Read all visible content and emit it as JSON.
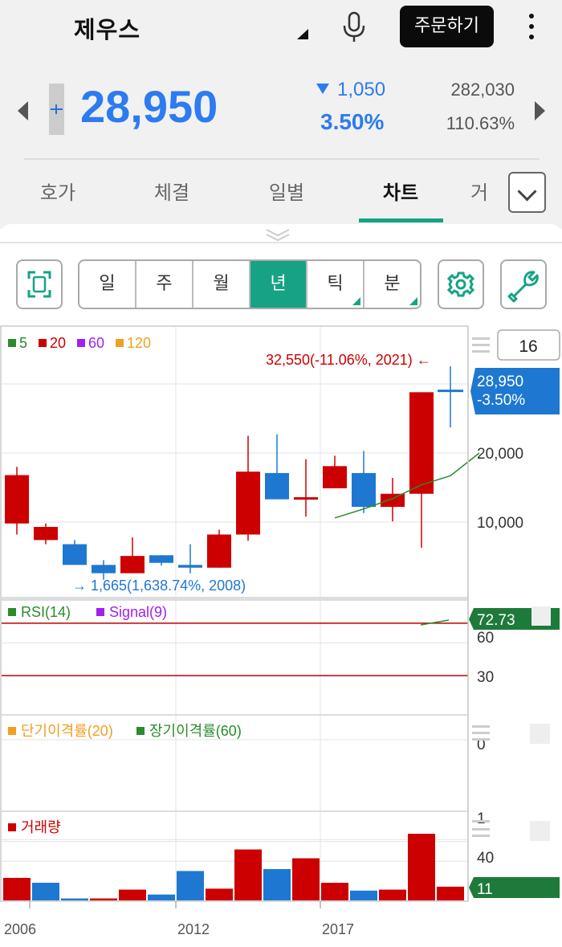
{
  "header": {
    "title": "제우스",
    "order_button": "주문하기"
  },
  "quote": {
    "price": "28,950",
    "change": "1,050",
    "change_pct": "3.50%",
    "volume": "282,030",
    "volume_ratio": "110.63%"
  },
  "tabs": [
    "호가",
    "체결",
    "일별",
    "차트",
    "거"
  ],
  "active_tab": "차트",
  "periods": [
    "일",
    "주",
    "월",
    "년",
    "틱",
    "분"
  ],
  "active_period": "년",
  "colors": {
    "accent": "#16a385",
    "up": "#cc0000",
    "down": "#1e78d2",
    "quote_blue": "#2d7bf0"
  },
  "icons": {
    "fullscreen": "fullscreen-icon",
    "settings": "gear-icon",
    "tools": "wrench-icon",
    "mic": "mic-icon",
    "more": "kebab-icon"
  },
  "chart_data": {
    "type": "candlestick",
    "period": "년",
    "x": [
      "2005",
      "2006",
      "2007",
      "2008",
      "2009",
      "2010",
      "2011",
      "2012",
      "2013",
      "2014",
      "2015",
      "2016",
      "2017",
      "2018",
      "2019",
      "2020",
      "2021"
    ],
    "xtick_labels": [
      "2006",
      "2012",
      "2017"
    ],
    "candles": [
      {
        "year": "2005",
        "open": 9800,
        "high": 18000,
        "low": 8200,
        "close": 16800
      },
      {
        "year": "2006",
        "open": 7400,
        "high": 9800,
        "low": 6800,
        "close": 9300
      },
      {
        "year": "2007",
        "open": 6800,
        "high": 7400,
        "low": 3800,
        "close": 3800
      },
      {
        "year": "2008",
        "open": 3800,
        "high": 4500,
        "low": 1665,
        "close": 2600
      },
      {
        "year": "2009",
        "open": 2600,
        "high": 7800,
        "low": 2600,
        "close": 5100
      },
      {
        "year": "2010",
        "open": 5200,
        "high": 5200,
        "low": 3700,
        "close": 4100
      },
      {
        "year": "2011",
        "open": 3800,
        "high": 6800,
        "low": 2600,
        "close": 3400
      },
      {
        "year": "2012",
        "open": 3400,
        "high": 8900,
        "low": 3400,
        "close": 8200
      },
      {
        "year": "2013",
        "open": 8200,
        "high": 22500,
        "low": 7300,
        "close": 17300
      },
      {
        "year": "2014",
        "open": 17100,
        "high": 22700,
        "low": 13900,
        "close": 13300
      },
      {
        "year": "2015",
        "open": 13300,
        "high": 19100,
        "low": 10800,
        "close": 13600
      },
      {
        "year": "2016",
        "open": 14900,
        "high": 19600,
        "low": 14900,
        "close": 18100
      },
      {
        "year": "2017",
        "open": 17100,
        "high": 20300,
        "low": 11300,
        "close": 12200
      },
      {
        "year": "2018",
        "open": 12200,
        "high": 16400,
        "low": 10100,
        "close": 14100
      },
      {
        "year": "2019",
        "open": 14100,
        "high": 28800,
        "low": 6300,
        "close": 28800
      },
      {
        "year": "2020",
        "open": 29000,
        "high": 32550,
        "low": 23700,
        "close": 28950
      }
    ],
    "ma5": [
      [
        11,
        10600
      ],
      [
        12,
        11900
      ],
      [
        13,
        13400
      ],
      [
        14,
        15400
      ],
      [
        15,
        16700
      ],
      [
        16,
        20000
      ]
    ],
    "legend_ma": [
      {
        "name": "5",
        "color": "#2a8c2a"
      },
      {
        "name": "20",
        "color": "#cc0000"
      },
      {
        "name": "60",
        "color": "#a020f0"
      },
      {
        "name": "120",
        "color": "#f0a020"
      }
    ],
    "y_ticks": [
      "20,000",
      "10,000"
    ],
    "max_label": "32,550(-11.06%, 2021)",
    "min_label": "1,665(1,638.74%, 2008)",
    "last_price": "28,950",
    "last_change": "-3.50%",
    "count_box": "16",
    "rsi": {
      "legend": [
        {
          "name": "RSI(14)",
          "color": "#2a8c2a"
        },
        {
          "name": "Signal(9)",
          "color": "#a020f0"
        }
      ],
      "ticks": [
        "60",
        "30"
      ],
      "value": "72.73",
      "lines": [
        70,
        30
      ]
    },
    "disparity": {
      "legend": [
        {
          "name": "단기이격률(20)",
          "color": "#f0a020"
        },
        {
          "name": "장기이격률(60)",
          "color": "#2a8c2a"
        }
      ],
      "ticks": [
        "0"
      ]
    },
    "volume": {
      "legend": [
        {
          "name": "거래량",
          "color": "#cc0000"
        }
      ],
      "ticks": [
        "1",
        "40"
      ],
      "value": "11",
      "values": [
        [
          23,
          "up"
        ],
        [
          18,
          "down"
        ],
        [
          2,
          "down"
        ],
        [
          2,
          "up"
        ],
        [
          11,
          "up"
        ],
        [
          6,
          "down"
        ],
        [
          30,
          "down"
        ],
        [
          12,
          "up"
        ],
        [
          52,
          "up"
        ],
        [
          32,
          "down"
        ],
        [
          43,
          "up"
        ],
        [
          18,
          "up"
        ],
        [
          10,
          "down"
        ],
        [
          11,
          "up"
        ],
        [
          68,
          "up"
        ],
        [
          14,
          "up"
        ]
      ]
    }
  }
}
